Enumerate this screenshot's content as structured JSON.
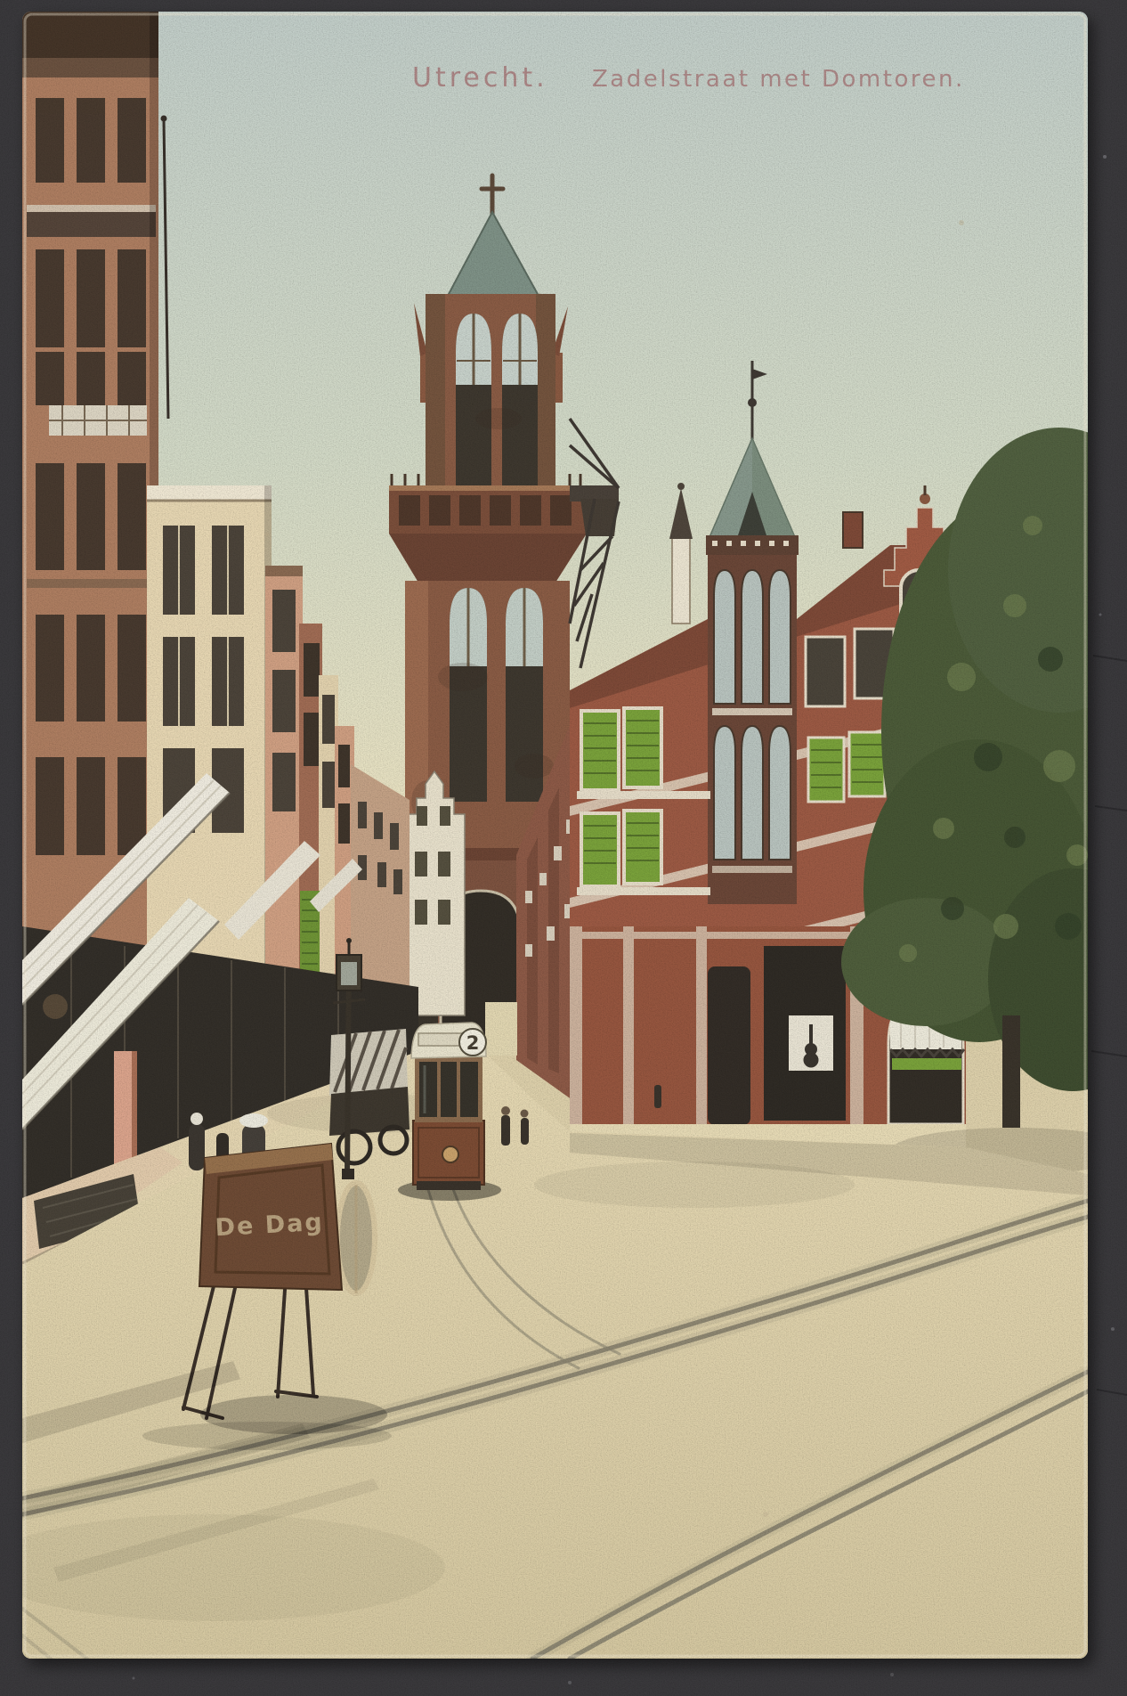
{
  "postcard": {
    "title": {
      "city": "Utrecht.",
      "subject": "Zadelstraat met Domtoren."
    },
    "tram": {
      "line_number": "2"
    },
    "cart": {
      "side_text": "De Dag"
    },
    "palette": {
      "table_surface": "#3a393c",
      "card_paper": "#efe8d6",
      "sky_top": "#c2cec9",
      "sky_horizon": "#f1e9c7",
      "street_sand": "#ddd0ab",
      "brick_red": "#9c5a44",
      "tower_brick": "#8a5c45",
      "slate_roof": "#87988c",
      "tree_green": "#4c5b39",
      "awning_white": "#eeeadb",
      "shutter_green": "#7aa23b",
      "title_ink": "#a87c7c"
    }
  }
}
